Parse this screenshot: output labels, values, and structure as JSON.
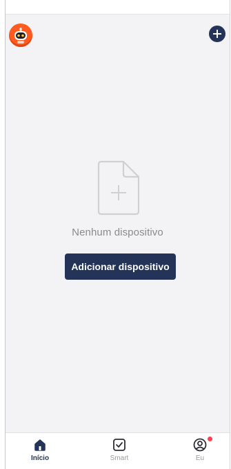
{
  "empty_state": {
    "message": "Nenhum dispositivo",
    "button_label": "Adicionar dispositivo"
  },
  "tabs": [
    {
      "label": "Início",
      "icon": "home-icon",
      "active": true
    },
    {
      "label": "Smart",
      "icon": "checkbox-icon",
      "active": false
    },
    {
      "label": "Eu",
      "icon": "user-icon",
      "active": false,
      "notification_dot": true
    }
  ],
  "header": {
    "avatar_icon": "robot-icon",
    "add_button_icon": "plus-circle-icon"
  },
  "colors": {
    "accent": "#243358",
    "avatar": "#ff5a1f",
    "notification_dot": "#ff4050",
    "background": "#f3f3f5",
    "muted_text": "#8a8a8f"
  }
}
